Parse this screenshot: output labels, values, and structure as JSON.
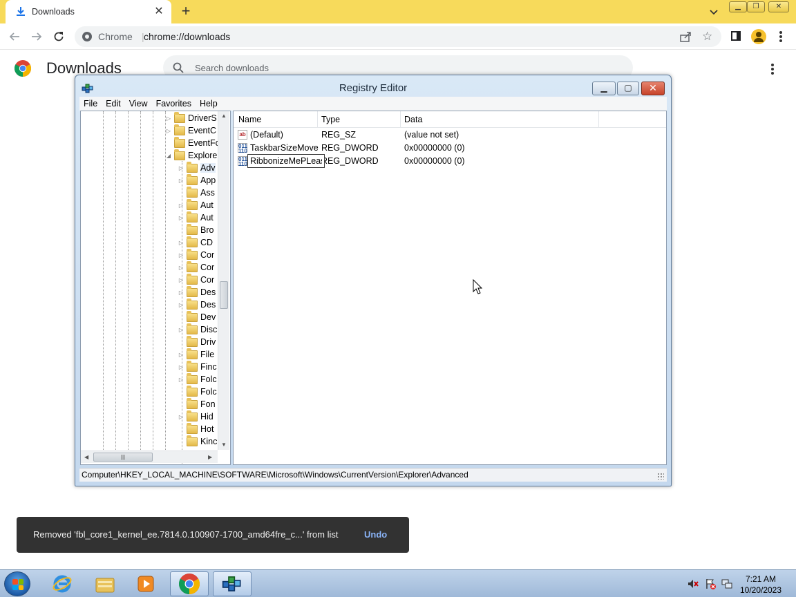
{
  "browser": {
    "tab_title": "Downloads",
    "omnibox_site": "Chrome",
    "omnibox_separator": "|",
    "omnibox_url": "chrome://downloads"
  },
  "page": {
    "title": "Downloads",
    "search_placeholder": "Search downloads"
  },
  "registry": {
    "title": "Registry Editor",
    "menu": [
      "File",
      "Edit",
      "View",
      "Favorites",
      "Help"
    ],
    "tree_items": [
      {
        "label": "DriverS",
        "depth": 0,
        "expander": "collapsed"
      },
      {
        "label": "EventC",
        "depth": 0,
        "expander": "collapsed"
      },
      {
        "label": "EventFo",
        "depth": 0,
        "expander": "none"
      },
      {
        "label": "Explore",
        "depth": 0,
        "expander": "expanded"
      },
      {
        "label": "Adv",
        "depth": 1,
        "expander": "collapsed",
        "selected": true
      },
      {
        "label": "App",
        "depth": 1,
        "expander": "collapsed"
      },
      {
        "label": "Ass",
        "depth": 1,
        "expander": "none"
      },
      {
        "label": "Aut",
        "depth": 1,
        "expander": "collapsed"
      },
      {
        "label": "Aut",
        "depth": 1,
        "expander": "collapsed"
      },
      {
        "label": "Bro",
        "depth": 1,
        "expander": "none"
      },
      {
        "label": "CD",
        "depth": 1,
        "expander": "collapsed"
      },
      {
        "label": "Cor",
        "depth": 1,
        "expander": "collapsed"
      },
      {
        "label": "Cor",
        "depth": 1,
        "expander": "collapsed"
      },
      {
        "label": "Cor",
        "depth": 1,
        "expander": "collapsed"
      },
      {
        "label": "Des",
        "depth": 1,
        "expander": "collapsed"
      },
      {
        "label": "Des",
        "depth": 1,
        "expander": "collapsed"
      },
      {
        "label": "Dev",
        "depth": 1,
        "expander": "none"
      },
      {
        "label": "Disc",
        "depth": 1,
        "expander": "collapsed"
      },
      {
        "label": "Driv",
        "depth": 1,
        "expander": "none"
      },
      {
        "label": "File",
        "depth": 1,
        "expander": "collapsed"
      },
      {
        "label": "Finc",
        "depth": 1,
        "expander": "collapsed"
      },
      {
        "label": "Folc",
        "depth": 1,
        "expander": "collapsed"
      },
      {
        "label": "Folc",
        "depth": 1,
        "expander": "none"
      },
      {
        "label": "Fon",
        "depth": 1,
        "expander": "none"
      },
      {
        "label": "Hid",
        "depth": 1,
        "expander": "collapsed"
      },
      {
        "label": "Hot",
        "depth": 1,
        "expander": "none"
      },
      {
        "label": "Kinc",
        "depth": 1,
        "expander": "none"
      }
    ],
    "columns": [
      "Name",
      "Type",
      "Data"
    ],
    "values": [
      {
        "icon": "string-value-icon",
        "name": "(Default)",
        "type": "REG_SZ",
        "data": "(value not set)"
      },
      {
        "icon": "dword-value-icon",
        "name": "TaskbarSizeMove",
        "type": "REG_DWORD",
        "data": "0x00000000 (0)"
      },
      {
        "icon": "dword-value-icon",
        "name": "RibbonizeMePLease",
        "type": "REG_DWORD",
        "data": "0x00000000 (0)",
        "editing": true
      }
    ],
    "status_path": "Computer\\HKEY_LOCAL_MACHINE\\SOFTWARE\\Microsoft\\Windows\\CurrentVersion\\Explorer\\Advanced"
  },
  "toast": {
    "message": "Removed 'fbl_core1_kernel_ee.7814.0.100907-1700_amd64fre_c...' from list",
    "action": "Undo"
  },
  "taskbar": {
    "time": "7:21 AM",
    "date": "10/20/2023"
  },
  "colors": {
    "tabstrip": "#f7da5b",
    "toast_bg": "#323232",
    "toast_action": "#8ab4f8",
    "taskbar": "#a9c2df"
  }
}
